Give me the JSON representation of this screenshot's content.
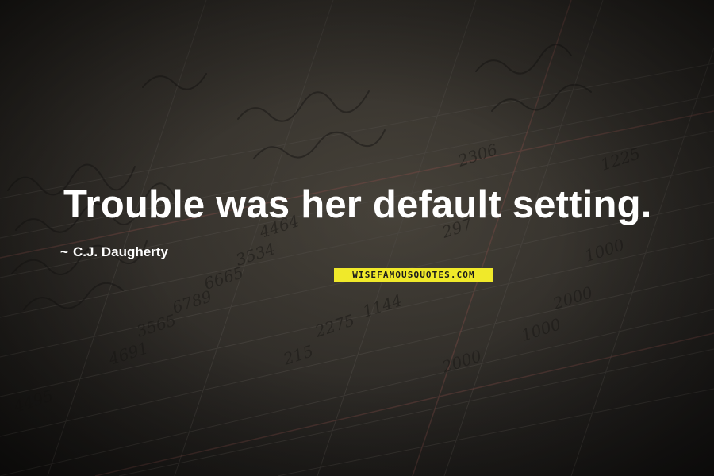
{
  "quote": {
    "text": "Trouble was her default setting.",
    "author": "C.J. Daugherty",
    "author_prefix": "~"
  },
  "watermark": {
    "text": "WISEFAMOUSQUOTES.COM"
  },
  "background": {
    "description_icon": "ledger-notebook-photo",
    "text_color": "#ffffff",
    "watermark_bg": "#f0e92a"
  }
}
